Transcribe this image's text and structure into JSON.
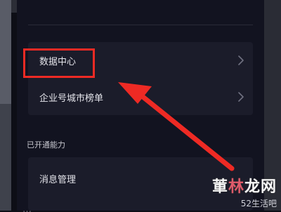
{
  "menu": {
    "items": [
      {
        "label": "数据中心"
      },
      {
        "label": "企业号城市榜单"
      }
    ]
  },
  "section": {
    "title": "已开通能力",
    "items": [
      {
        "label": "消息管理"
      },
      {
        "label": "…"
      }
    ]
  },
  "annotation": {
    "color": "#ee2a24"
  },
  "watermark": {
    "main_pre": "莗",
    "main_accent": "林",
    "main_post": "龙网",
    "sub": "52生活吧"
  },
  "icons": {
    "chevron": "chevron-right-icon",
    "arrow": "annotation-arrow-icon"
  },
  "colors": {
    "background": "#121320",
    "card": "#1b1c2a",
    "highlight": "#ee2a24"
  }
}
